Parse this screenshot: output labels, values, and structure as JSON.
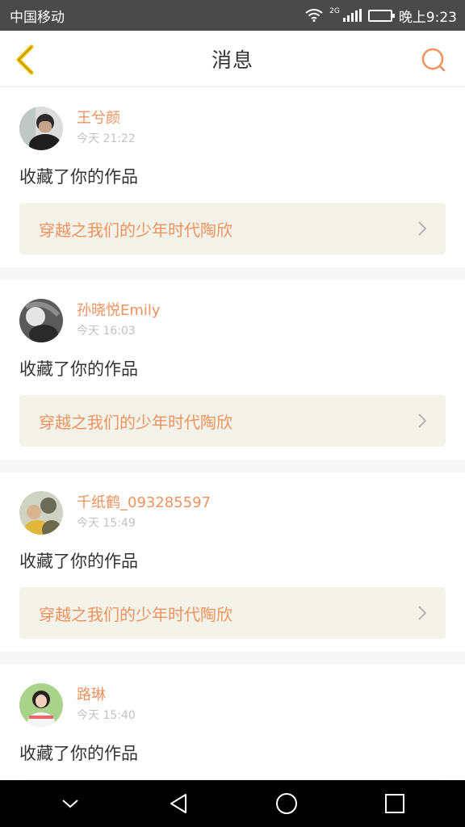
{
  "status_bar": {
    "carrier": "中国移动",
    "network_tag": "2G",
    "time": "晚上9:23"
  },
  "header": {
    "title": "消息"
  },
  "messages": [
    {
      "name": "王兮颜",
      "time": "今天 21:22",
      "action": "收藏了你的作品",
      "work_title": "穿越之我们的少年时代陶欣"
    },
    {
      "name": "孙晓悦Emily",
      "time": "今天 16:03",
      "action": "收藏了你的作品",
      "work_title": "穿越之我们的少年时代陶欣"
    },
    {
      "name": "千纸鹤_093285597",
      "time": "今天 15:49",
      "action": "收藏了你的作品",
      "work_title": "穿越之我们的少年时代陶欣"
    },
    {
      "name": "路琳",
      "time": "今天 15:40",
      "action": "收藏了你的作品",
      "work_title": ""
    }
  ],
  "colors": {
    "accent": "#f0925f",
    "back_arrow": "#f2c200",
    "work_bg": "#f4f3ea"
  },
  "icons": {
    "back": "back-arrow-icon",
    "search": "search-icon",
    "chevron": "chevron-right-icon",
    "sys_nav": [
      "collapse-icon",
      "back-triangle-icon",
      "home-circle-icon",
      "recents-square-icon"
    ]
  }
}
